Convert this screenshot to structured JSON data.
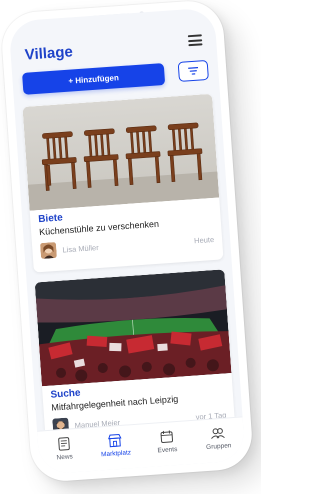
{
  "app": {
    "title": "Village"
  },
  "toolbar": {
    "add_label": "+ Hinzufügen"
  },
  "listings": [
    {
      "type": "Biete",
      "title": "Küchenstühle zu verschenken",
      "author": "Lisa Müller",
      "time": "Heute"
    },
    {
      "type": "Suche",
      "title": "Mitfahrgelegenheit nach Leipzig",
      "author": "Manuel Meier",
      "time": "vor 1 Tag"
    }
  ],
  "bottom_nav": {
    "items": [
      {
        "label": "News",
        "icon": "news-icon"
      },
      {
        "label": "Marktplatz",
        "icon": "marketplace-icon"
      },
      {
        "label": "Events",
        "icon": "calendar-icon"
      },
      {
        "label": "Gruppen",
        "icon": "group-icon"
      }
    ],
    "active": "Marktplatz"
  },
  "colors": {
    "accent": "#1643e8",
    "title": "#1f43c9",
    "muted": "#a7abb6",
    "background": "#f4f6fa"
  }
}
